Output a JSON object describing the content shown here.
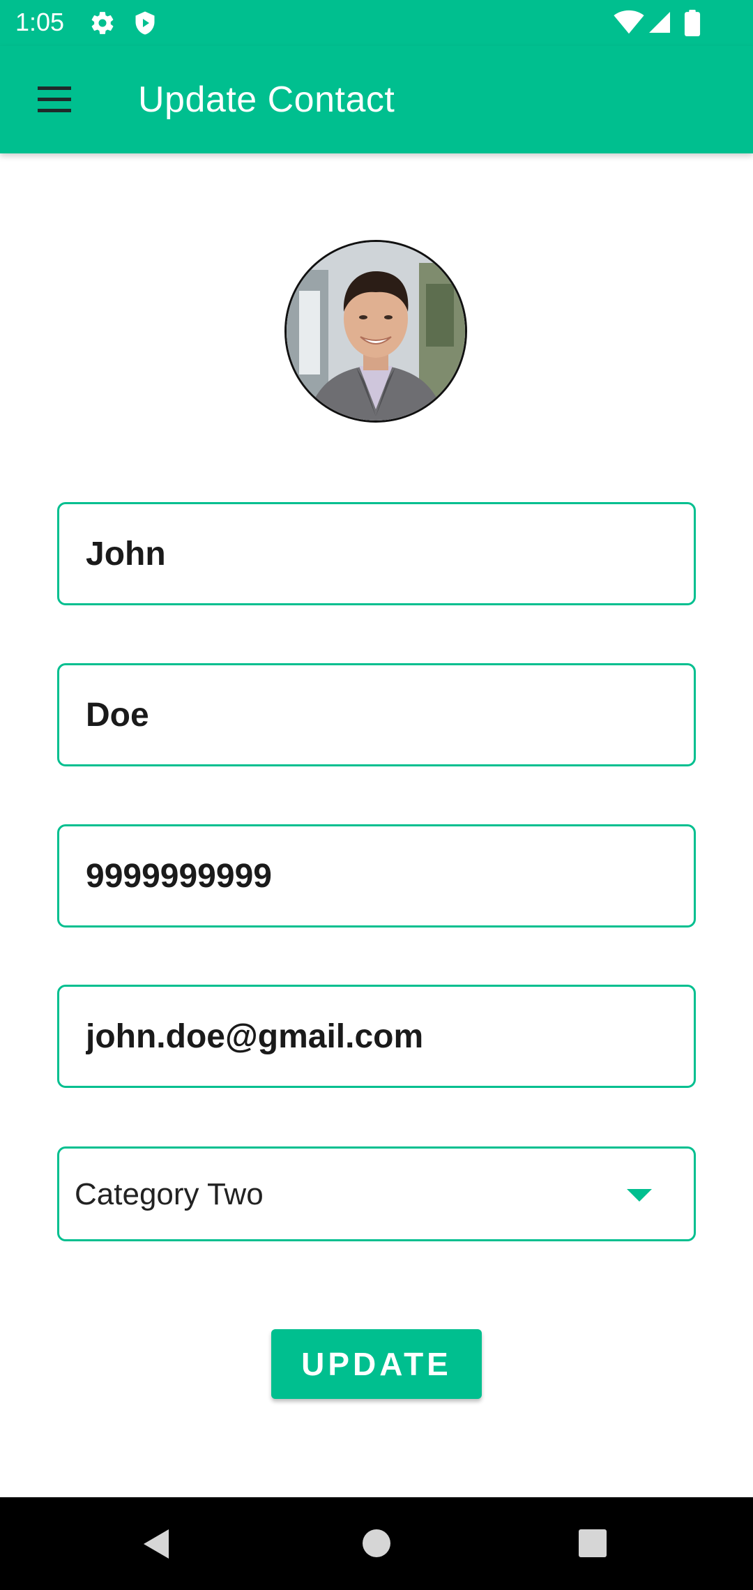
{
  "status_bar": {
    "time": "1:05",
    "icons": [
      "gear-icon",
      "shield-icon",
      "wifi-icon",
      "signal-icon",
      "battery-icon"
    ]
  },
  "app_bar": {
    "title": "Update Contact",
    "menu_icon": "hamburger-menu-icon"
  },
  "avatar": {
    "icon": "contact-photo"
  },
  "form": {
    "first_name": "John",
    "last_name": "Doe",
    "phone": "9999999999",
    "email": "john.doe@gmail.com",
    "category": "Category Two",
    "category_icon": "dropdown-arrow-icon"
  },
  "update_button": {
    "label": "UPDATE"
  },
  "nav_bar": {
    "icons": [
      "back-icon",
      "home-icon",
      "recents-icon"
    ]
  },
  "colors": {
    "primary": "#00BF8F",
    "text": "#1a1a1a",
    "nav_background": "#000000"
  }
}
